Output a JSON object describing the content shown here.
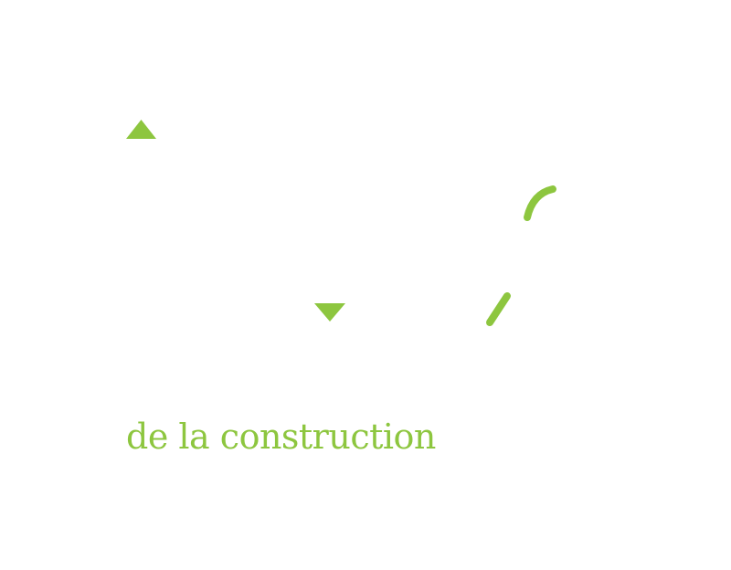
{
  "tagline": "de la construction",
  "colors": {
    "accent": "#8dc63f",
    "background": "#ffffff"
  },
  "marks": [
    {
      "name": "triangle-up-icon",
      "shape": "triangle-up"
    },
    {
      "name": "triangle-down-icon",
      "shape": "triangle-down"
    },
    {
      "name": "arc-stroke-icon",
      "shape": "arc"
    },
    {
      "name": "slash-stroke-icon",
      "shape": "slash"
    }
  ]
}
